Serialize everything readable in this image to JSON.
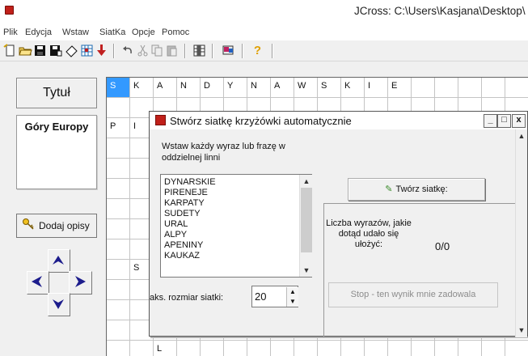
{
  "window": {
    "title": "JCross: C:\\Users\\Kasjana\\Desktop\\"
  },
  "menu": [
    "Plik",
    "Edycja",
    "Wstaw",
    "SiatKa",
    "Opcje",
    "Pomoc"
  ],
  "toolbar": {
    "help_glyph": "?"
  },
  "left_panel": {
    "title_label": "Tytuł",
    "title_value": "Góry Europy",
    "add_desc_label": "Dodaj opisy"
  },
  "grid": {
    "row0": [
      "S",
      "K",
      "A",
      "N",
      "D",
      "Y",
      "N",
      "A",
      "W",
      "S",
      "K",
      "I",
      "E"
    ],
    "row2": [
      "P",
      "I"
    ],
    "s_letter": "S",
    "l_letter": "L",
    "edge_letter": "e"
  },
  "dialog": {
    "title": "Stwórz siatkę krzyżówki automatycznie",
    "instruction": "Wstaw każdy wyraz lub frazę w oddzielnej linni",
    "words": [
      "DYNARSKIE",
      "PIRENEJE",
      "KARPATY",
      "SUDETY",
      "URAL",
      "ALPY",
      "APENINY",
      "KAUKAZ"
    ],
    "create_button": "Twórz siatkę:",
    "count_label": "Liczba wyrazów, jakie dotąd udało się ułożyć:",
    "count_value": "0/0",
    "max_size_label": "aks. rozmiar siatki:",
    "max_size_value": "20",
    "stop_button": "Stop - ten wynik mnie zadowala",
    "ctrl_min": "_",
    "ctrl_max": "□",
    "ctrl_close": "x"
  },
  "colors": {
    "selection": "#3399ff",
    "app_red": "#c0201a",
    "arrow_navy": "#1c1c8c"
  }
}
